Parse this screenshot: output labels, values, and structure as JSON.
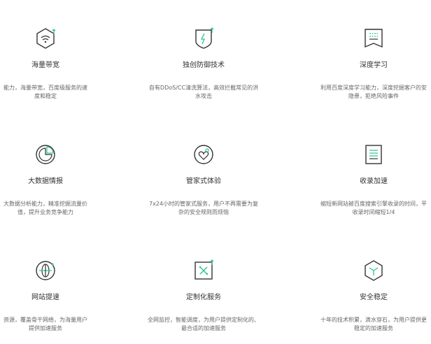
{
  "features": [
    {
      "title": "海量带宽",
      "line1": "能力，海量带宽，百度级服务的速",
      "line2": "度和稳定",
      "icon": "wifi-shield-icon"
    },
    {
      "title": "独创防御技术",
      "line1": "自有DDoS/CC清洗算法，高效拦截常见的洪",
      "line2": "水攻击",
      "icon": "lightning-shield-icon"
    },
    {
      "title": "深度学习",
      "line1": "利用百度深度学习能力，深度挖掘客户的安",
      "line2": "隐患，拒绝风险事件",
      "icon": "book-icon"
    },
    {
      "title": "大数据情报",
      "line1": "大数据分析能力，精准挖掘流量价",
      "line2": "值，提升业务竞争能力",
      "icon": "chart-circle-icon"
    },
    {
      "title": "管家式体验",
      "line1": "7x24小时的管家式服务，用户不再需要为复",
      "line2": "杂的安全规则而烦恼",
      "icon": "heart-circle-icon"
    },
    {
      "title": "收录加速",
      "line1": "缩短新网站被百度搜索引擎收录的时间，平",
      "line2": "收录时间缩短1/4",
      "icon": "list-doc-icon"
    },
    {
      "title": "网站提速",
      "line1": "资源，覆盖骨干网络，为海量用户",
      "line2": "提供加速服务",
      "icon": "globe-icon"
    },
    {
      "title": "定制化服务",
      "line1": "全网监控，智能调度，为用户提供定制化的、",
      "line2": "最合适的加速服务",
      "icon": "tools-square-icon"
    },
    {
      "title": "安全稳定",
      "line1": "十年的技术积累，滴水穿石，为用户提供更",
      "line2": "稳定的加速服务",
      "icon": "cube-icon"
    }
  ],
  "colors": {
    "stroke": "#333333",
    "accent": "#2fc38a"
  }
}
